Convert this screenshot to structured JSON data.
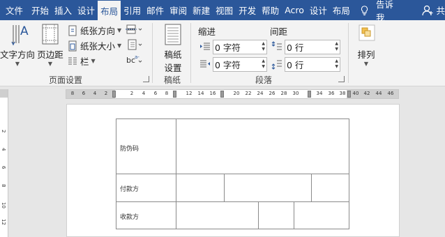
{
  "tabs": [
    {
      "label": "文件",
      "active": false
    },
    {
      "label": "开始",
      "active": false
    },
    {
      "label": "插入",
      "active": false
    },
    {
      "label": "设计",
      "active": false
    },
    {
      "label": "布局",
      "active": true
    },
    {
      "label": "引用",
      "active": false
    },
    {
      "label": "邮件",
      "active": false
    },
    {
      "label": "审阅",
      "active": false
    },
    {
      "label": "新建",
      "active": false
    },
    {
      "label": "视图",
      "active": false
    },
    {
      "label": "开发",
      "active": false
    },
    {
      "label": "帮助",
      "active": false
    },
    {
      "label": "Acro",
      "active": false
    },
    {
      "label": "设计",
      "active": false
    },
    {
      "label": "布局",
      "active": false
    }
  ],
  "tell_me": "告诉我",
  "share": "共",
  "ribbon": {
    "page_setup": {
      "text_direction": "文字方向",
      "margins": "页边距",
      "orientation": "纸张方向",
      "size": "纸张大小",
      "columns": "栏",
      "group_label": "页面设置"
    },
    "manuscript": {
      "button_line1": "稿纸",
      "button_line2": "设置",
      "group_label": "稿纸"
    },
    "paragraph": {
      "indent_label": "缩进",
      "spacing_label": "间距",
      "indent_left": "0 字符",
      "indent_right": "0 字符",
      "spacing_before": "0 行",
      "spacing_after": "0 行",
      "group_label": "段落"
    },
    "arrange": {
      "label": "排列"
    }
  },
  "ruler": {
    "ticks": [
      "8",
      "6",
      "4",
      "2",
      "2",
      "4",
      "6",
      "8",
      "12",
      "14",
      "16",
      "20",
      "22",
      "24",
      "26",
      "28",
      "30",
      "34",
      "36",
      "38",
      "40",
      "42",
      "44",
      "46"
    ],
    "vticks": [
      "2",
      "4",
      "6",
      "8",
      "10",
      "12"
    ]
  },
  "table": {
    "row1_label": "防伪码",
    "row2_label": "付款方",
    "row3_label": "收款方"
  }
}
